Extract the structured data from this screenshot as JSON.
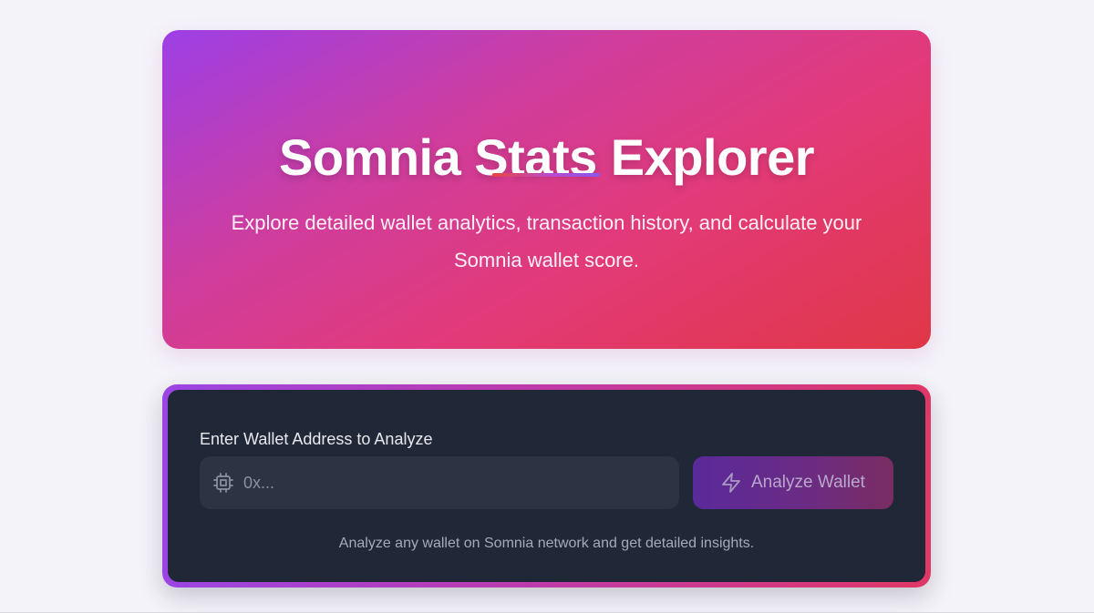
{
  "hero": {
    "title": "Somnia Stats Explorer",
    "subtitle": "Explore detailed wallet analytics, transaction history, and calculate your Somnia wallet score."
  },
  "analyzer": {
    "label": "Enter Wallet Address to Analyze",
    "input_placeholder": "0x...",
    "input_value": "",
    "input_icon": "chip-icon",
    "button_label": "Analyze Wallet",
    "button_icon": "lightning-icon",
    "hint": "Analyze any wallet on Somnia network and get detailed insights."
  },
  "colors": {
    "page_background": "#f4f3f9",
    "hero_gradient_start": "#9d3fe6",
    "hero_gradient_end": "#e03746",
    "card_background": "#202736",
    "input_background": "#2c3444"
  }
}
